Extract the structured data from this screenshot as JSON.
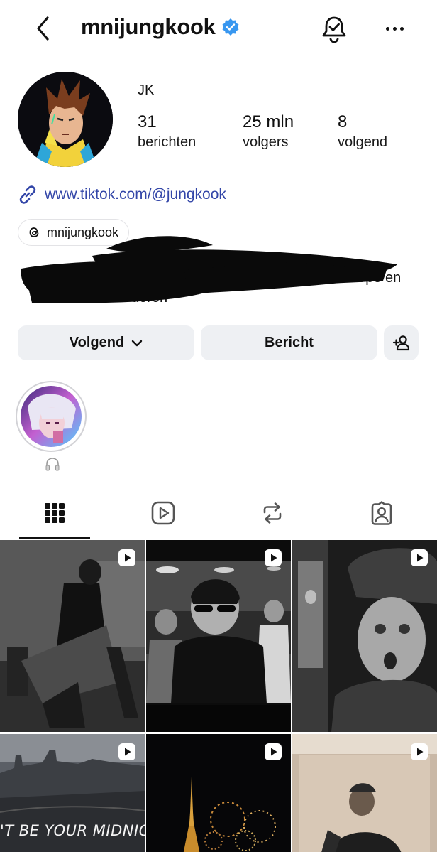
{
  "header": {
    "username": "mnijungkook",
    "icons": {
      "back": "chevron-left-icon",
      "verified": "verified-badge-icon",
      "bell": "notification-bell-icon",
      "more": "more-dots-icon"
    }
  },
  "profile": {
    "display_name": "JK",
    "stats": [
      {
        "value": "31",
        "label": "berichten"
      },
      {
        "value": "25 mln",
        "label": "volgers"
      },
      {
        "value": "8",
        "label": "volgend"
      }
    ],
    "link": "www.tiktok.com/@jungkook",
    "threads_handle": "mnijungkook",
    "bio_visible_fragments": [
      "hope en",
      "deren"
    ]
  },
  "actions": {
    "follow_label": "Volgend",
    "message_label": "Bericht",
    "add_user_icon": "add-user-icon"
  },
  "highlight": {
    "label_icon": "headphones-icon"
  },
  "tabs": [
    "grid-icon",
    "reels-icon",
    "reposts-icon",
    "tagged-icon"
  ],
  "grid": {
    "posts": [
      {
        "type": "reel",
        "overlay_text": ""
      },
      {
        "type": "reel",
        "overlay_text": ""
      },
      {
        "type": "reel",
        "overlay_text": ""
      },
      {
        "type": "reel",
        "overlay_text": "'T BE YOUR MIDNIGHT"
      },
      {
        "type": "reel",
        "overlay_text": ""
      },
      {
        "type": "reel",
        "overlay_text": ""
      }
    ]
  },
  "colors": {
    "link": "#3346a8",
    "verified": "#3897f0",
    "button_bg": "#eef0f3"
  }
}
